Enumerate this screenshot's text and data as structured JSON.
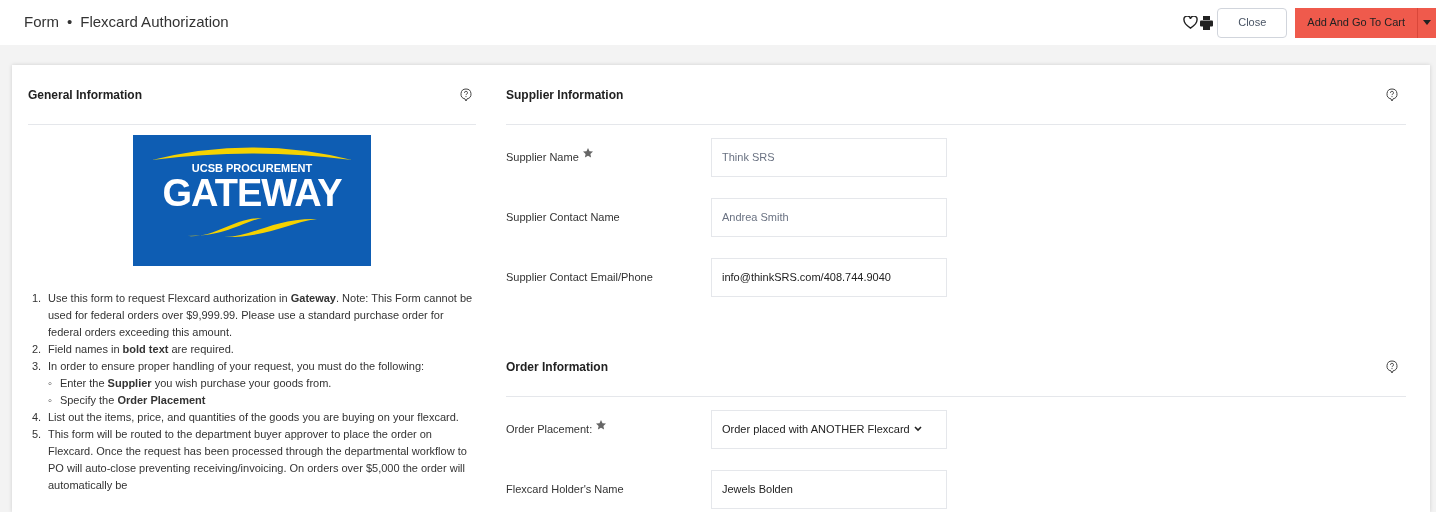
{
  "header": {
    "breadcrumb": [
      "Form",
      "Flexcard Authorization"
    ],
    "separator": "•",
    "buttons": [
      {
        "kind": "secondary",
        "label": "Close"
      },
      {
        "kind": "primary",
        "label": "Add And Go To Cart"
      }
    ]
  },
  "general": {
    "title": "General Information",
    "logo": {
      "subtitle": "UCSB PROCUREMENT",
      "title": "GATEWAY"
    },
    "instructions": [
      {
        "marker": "1.",
        "text": "Use this form to request Flexcard authorization in **Gateway**. Note: This Form cannot be used for federal orders over $9,999.99. Please use a standard purchase order for federal orders exceeding this amount."
      },
      {
        "marker": "2.",
        "text": "Field names in **bold text** are required."
      },
      {
        "marker": "3.",
        "text": "In order to ensure proper handling of your request, you must do the following:",
        "children": [
          {
            "marker": "◦",
            "text": "Enter the **Supplier** you wish purchase your goods from."
          },
          {
            "marker": "◦",
            "text": "Specify the **Order Placement**"
          }
        ]
      },
      {
        "marker": "4.",
        "text": "List out the items, price, and quantities of the goods you are buying on your flexcard."
      },
      {
        "marker": "5.",
        "text": "This form will be routed to the department buyer approver to place the order on Flexcard. Once the request has been processed through the departmental workflow to PO will auto-close preventing receiving/invoicing. On orders over $5,000 the order will automatically be"
      }
    ]
  },
  "sections": [
    {
      "title": "Supplier Information",
      "fields": [
        {
          "label": "Supplier Name",
          "required": true,
          "kind": "input",
          "placeholder": "Think SRS"
        },
        {
          "label": "Supplier Contact Name",
          "required": false,
          "kind": "input",
          "placeholder": "Andrea Smith"
        },
        {
          "label": "Supplier Contact Email/Phone",
          "required": false,
          "kind": "input",
          "value": "info@thinkSRS.com/408.744.9040"
        }
      ]
    },
    {
      "title": "Order Information",
      "fields": [
        {
          "label": "Order Placement:",
          "required": true,
          "kind": "select",
          "value": "Order placed with ANOTHER Flexcard"
        },
        {
          "label": "Flexcard Holder's Name",
          "required": false,
          "kind": "input",
          "value": "Jewels Bolden"
        }
      ]
    }
  ]
}
